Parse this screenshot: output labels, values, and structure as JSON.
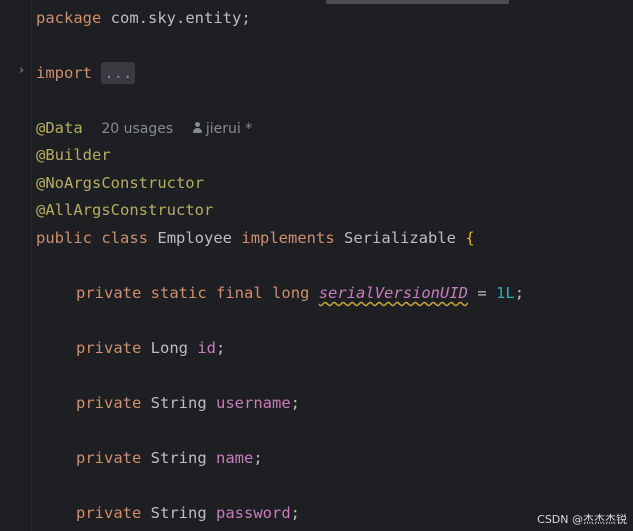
{
  "editor": {
    "package_line": {
      "keyword": "package",
      "name": "com.sky.entity;"
    },
    "import_line": {
      "keyword": "import",
      "folded": "..."
    },
    "class_annotations": {
      "data": "@Data",
      "usages_hint": "20 usages",
      "author_hint": "jierui *",
      "builder": "@Builder",
      "no_args": "@NoArgsConstructor",
      "all_args": "@AllArgsConstructor"
    },
    "class_decl": {
      "public": "public",
      "class": "class",
      "name": "Employee",
      "implements": "implements",
      "interface": "Serializable",
      "brace": "{"
    },
    "serial_field": {
      "private": "private",
      "static": "static",
      "final": "final",
      "long": "long",
      "name": "serialVersionUID",
      "assign": "=",
      "value": "1L",
      "end": ";"
    },
    "fields": [
      {
        "modifier": "private",
        "type": "Long",
        "name": "id",
        "end": ";"
      },
      {
        "modifier": "private",
        "type": "String",
        "name": "username",
        "end": ";"
      },
      {
        "modifier": "private",
        "type": "String",
        "name": "name",
        "end": ";"
      },
      {
        "modifier": "private",
        "type": "String",
        "name": "password",
        "end": ";"
      }
    ],
    "icons": {
      "fold": "chevron-right-icon",
      "author": "person-icon"
    }
  },
  "watermark": "CSDN @杰杰杰锐"
}
